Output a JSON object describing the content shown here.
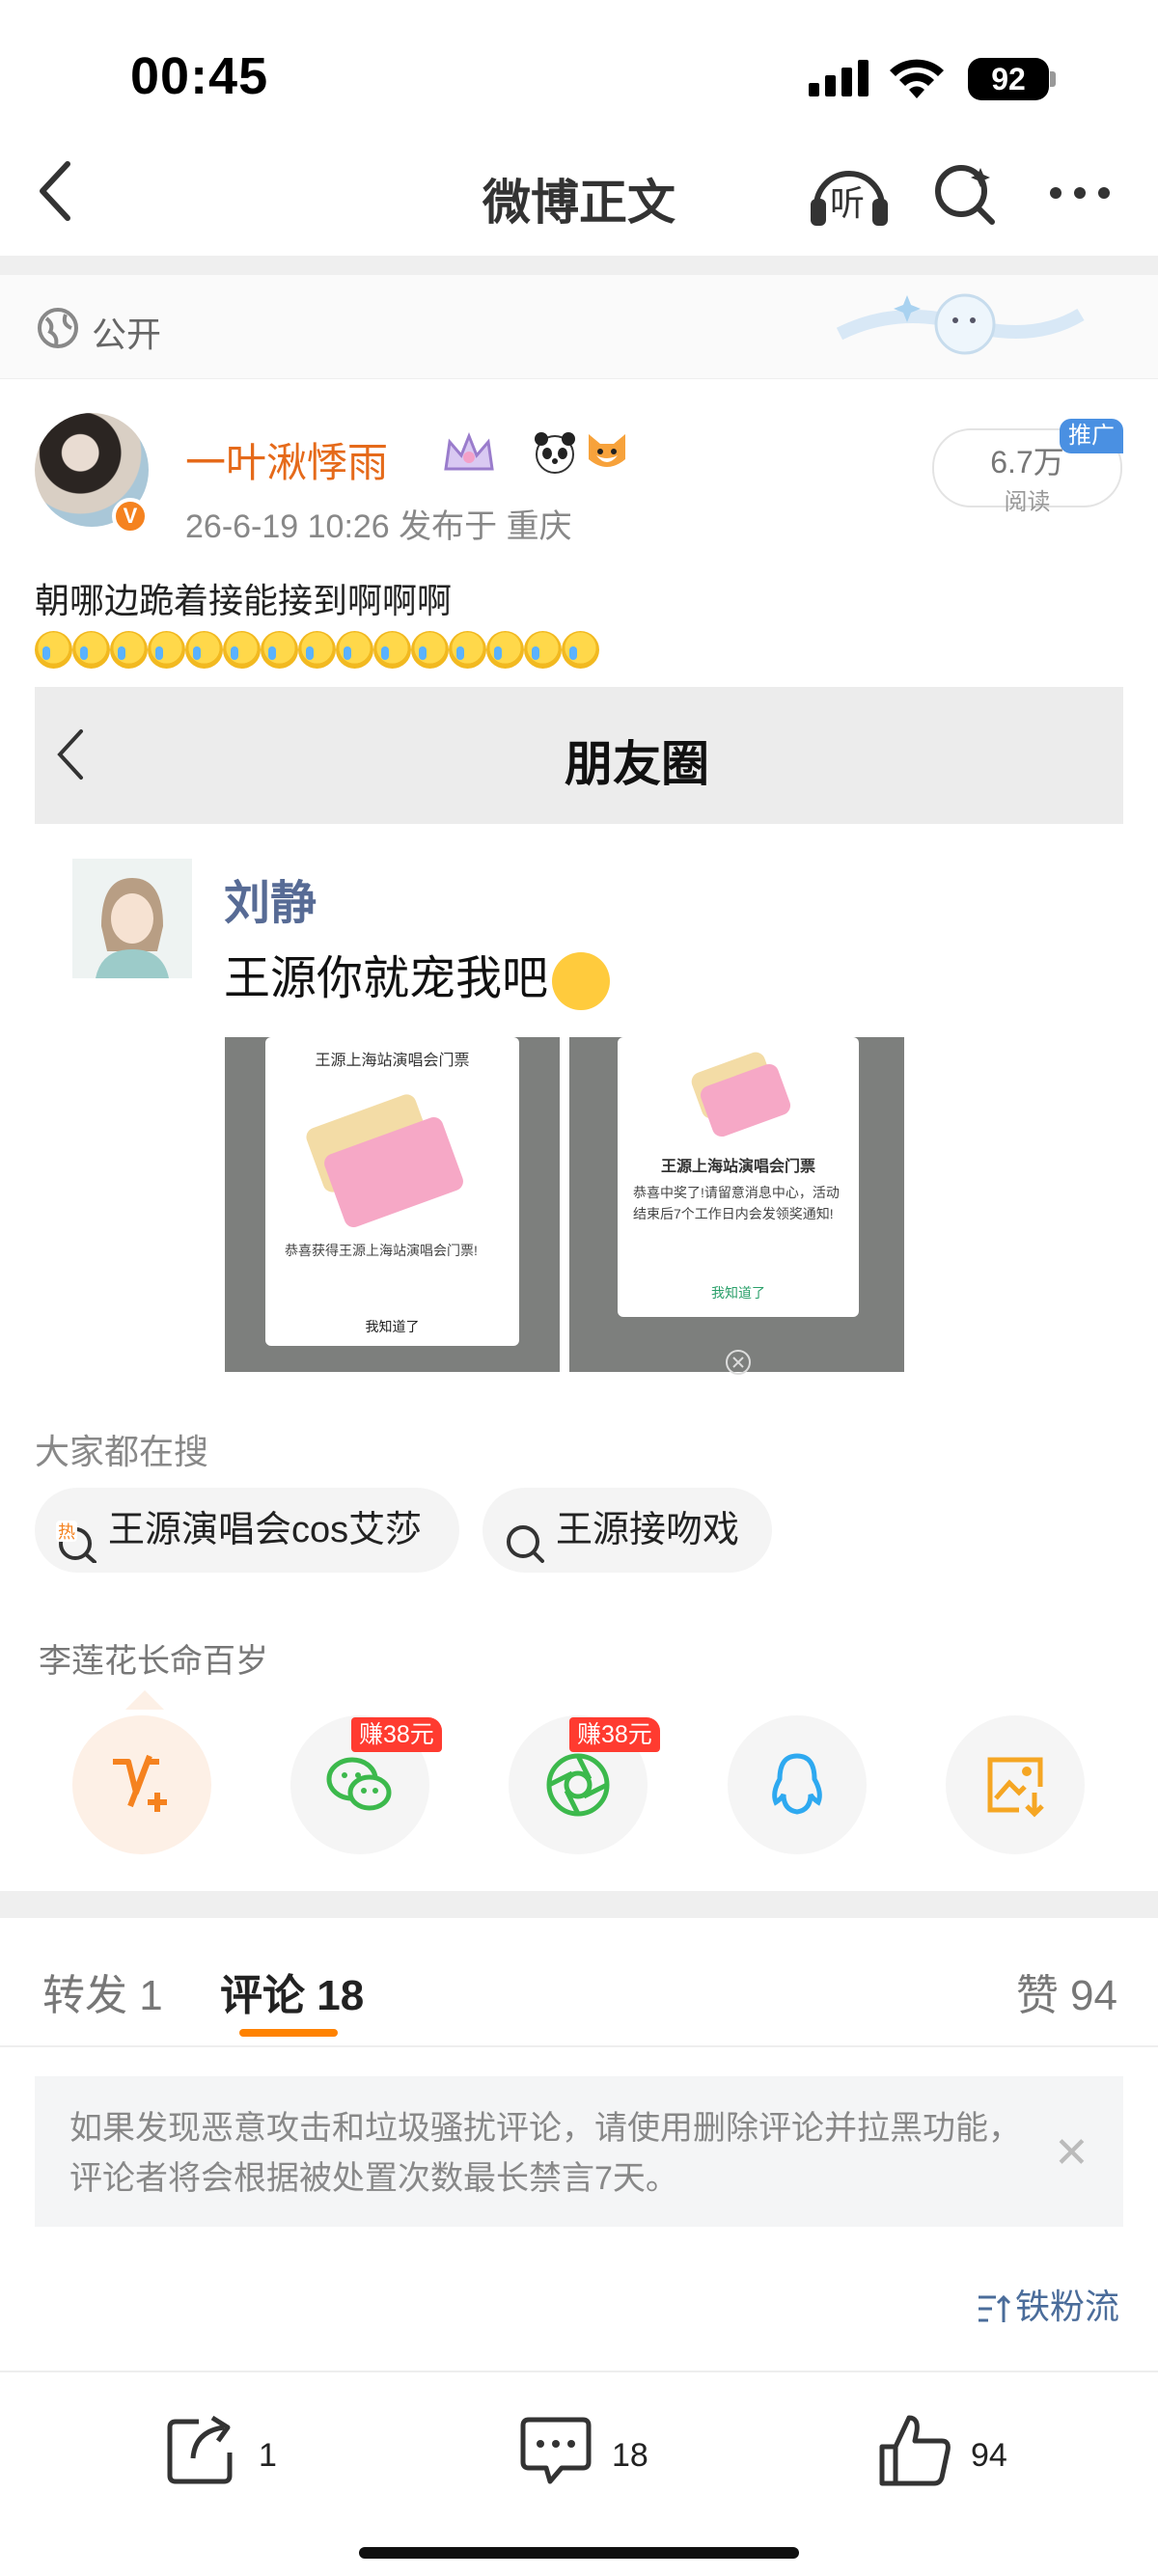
{
  "status_bar": {
    "time": "00:45",
    "battery": "92"
  },
  "nav": {
    "title": "微博正文",
    "listen_label": "听"
  },
  "visibility": {
    "label": "公开"
  },
  "post": {
    "username": "一叶湫悸雨",
    "badge_v": "V",
    "meta": "26-6-19 10:26  发布于 重庆",
    "reads_value": "6.7万",
    "reads_label": "阅读",
    "promo_label": "推广",
    "text": "朝哪边跪着接能接到啊啊啊"
  },
  "embedded": {
    "title": "朋友圈",
    "friend_name": "刘静",
    "friend_text": "王源你就宠我吧",
    "image1": {
      "title": "王源上海站演唱会门票",
      "text": "恭喜获得王源上海站演唱会门票!",
      "button": "我知道了"
    },
    "image2": {
      "title": "王源上海站演唱会门票",
      "text": "恭喜中奖了!请留意消息中心，活动结束后7个工作日内会发领奖通知!",
      "button": "我知道了"
    }
  },
  "search": {
    "label": "大家都在搜",
    "chips": [
      {
        "text": "王源演唱会cos艾莎",
        "hot": "热"
      },
      {
        "text": "王源接吻戏"
      }
    ]
  },
  "trend": {
    "label": "李莲花长命百岁"
  },
  "share": {
    "earn_label": "赚38元"
  },
  "tabs": {
    "repost": "转发 1",
    "comment": "评论 18",
    "like": "赞 94"
  },
  "notice": {
    "text": "如果发现恶意攻击和垃圾骚扰评论，请使用删除评论并拉黑功能，评论者将会根据被处置次数最长禁言7天。",
    "close": "✕"
  },
  "sort": {
    "label": "铁粉流"
  },
  "actions": {
    "share_count": "1",
    "comment_count": "18",
    "like_count": "94"
  }
}
